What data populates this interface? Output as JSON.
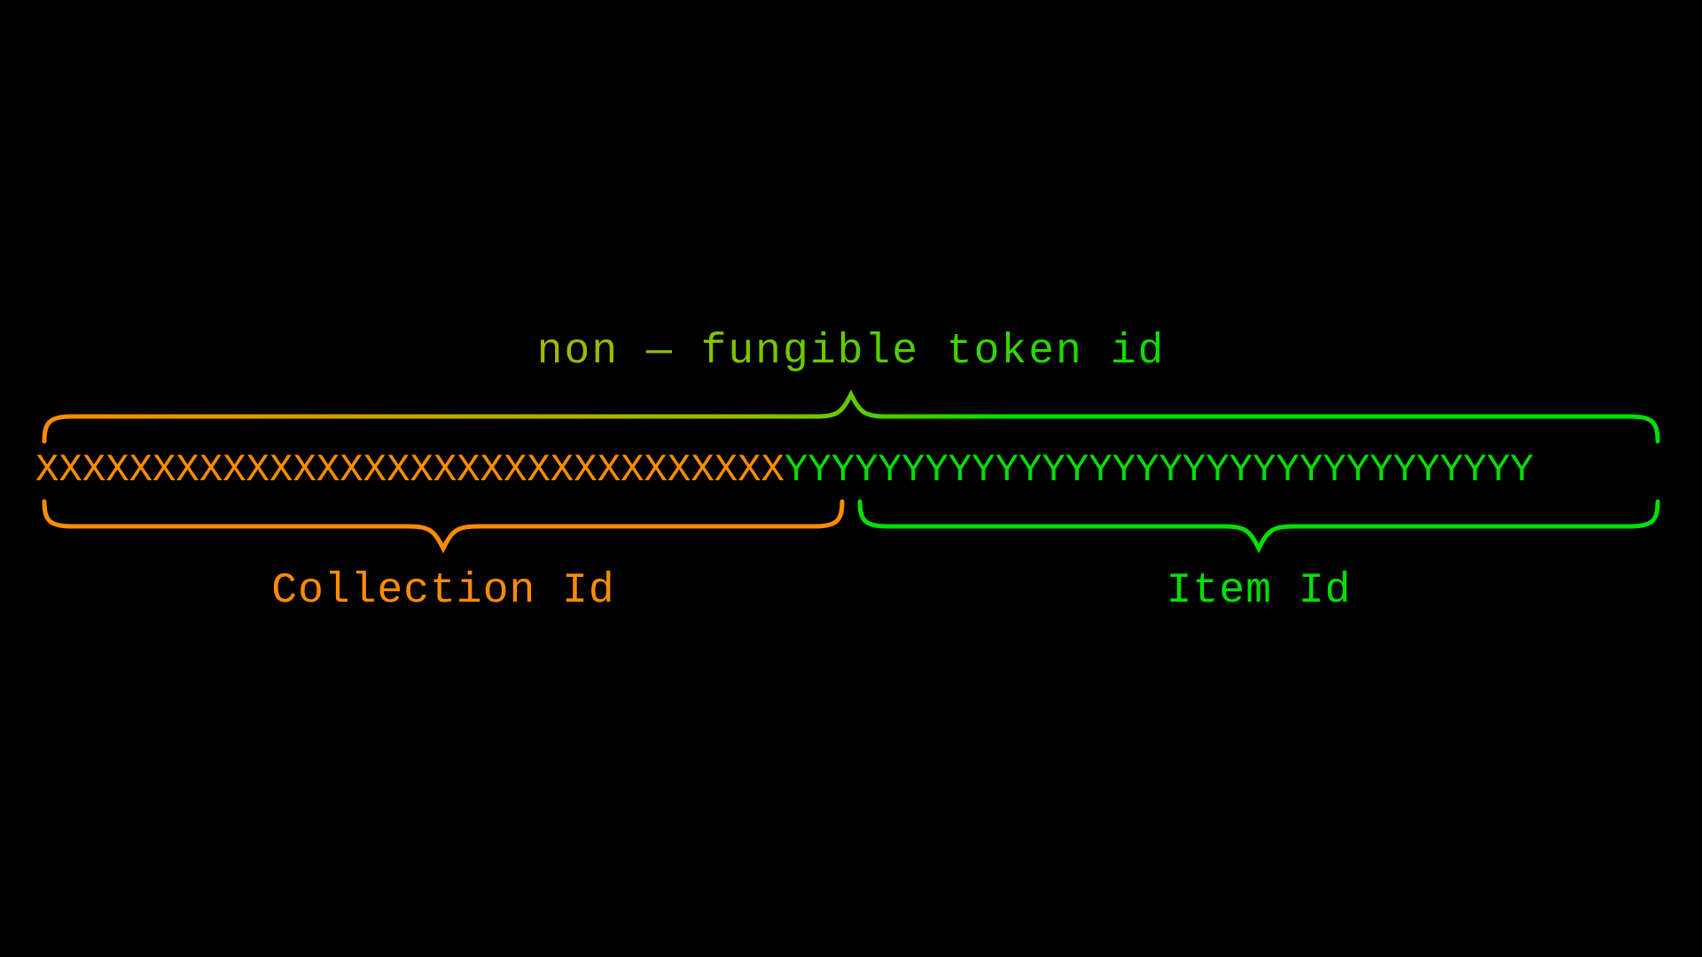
{
  "title": "non — fungible token id",
  "token": {
    "collection_chars": "XXXXXXXXXXXXXXXXXXXXXXXXXXXXXXXX",
    "item_chars": "YYYYYYYYYYYYYYYYYYYYYYYYYYYYYYYY"
  },
  "labels": {
    "collection": "Collection Id",
    "item": "Item Id"
  },
  "colors": {
    "collection": "#ff8c00",
    "item": "#00e000",
    "bg": "#000000"
  }
}
